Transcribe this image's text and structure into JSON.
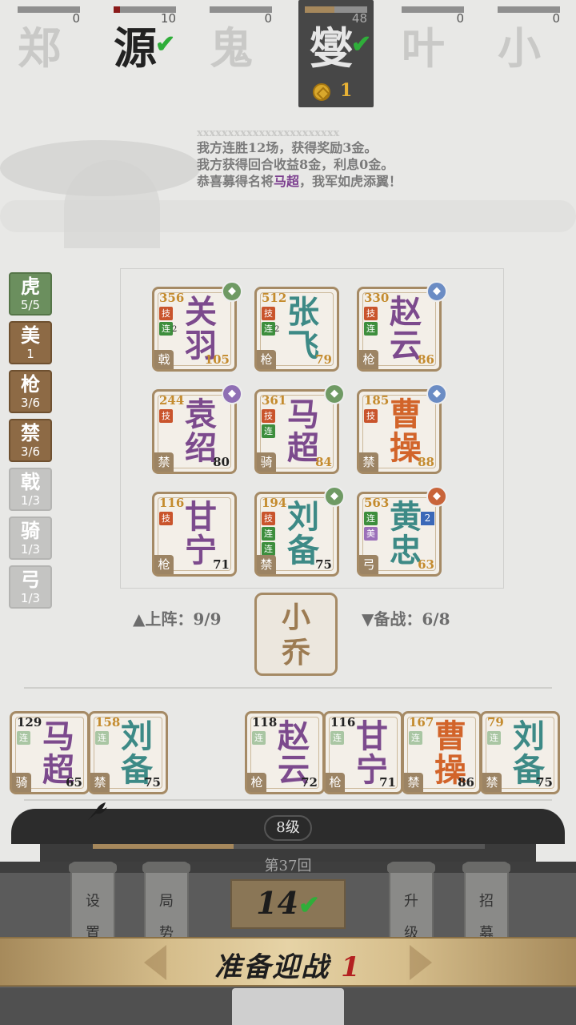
{
  "players": [
    {
      "name": "郑",
      "hp": 0,
      "hp_fill": 0,
      "style": "faded"
    },
    {
      "name": "源",
      "hp": 10,
      "hp_fill": 0.1,
      "style": "dark",
      "ready": "✔"
    },
    {
      "name": "鬼",
      "hp": 0,
      "hp_fill": 0,
      "style": "faded"
    },
    {
      "name": "燮",
      "hp": 48,
      "hp_fill": 0.48,
      "style": "self",
      "ready": "✔",
      "gold": "1"
    },
    {
      "name": "叶",
      "hp": 0,
      "hp_fill": 0,
      "style": "faded"
    },
    {
      "name": "小",
      "hp": 0,
      "hp_fill": 0,
      "style": "faded"
    }
  ],
  "log": {
    "faded_line": "xxxxxxxxxxxxxxxxxxxxxxx",
    "line1": "我方连胜12场，获得奖励3金。",
    "line2": "我方获得回合收益8金，利息0金。",
    "line3_pre": "恭喜募得名将",
    "line3_hero": "马超",
    "line3_post": "，我军如虎添翼！"
  },
  "traits": [
    {
      "name": "虎",
      "count": "5/5",
      "color": "green"
    },
    {
      "name": "美",
      "count": "1",
      "color": "brown"
    },
    {
      "name": "枪",
      "count": "3/6",
      "color": "brown"
    },
    {
      "name": "禁",
      "count": "3/6",
      "color": "brown"
    },
    {
      "name": "戟",
      "count": "1/3",
      "color": "grey"
    },
    {
      "name": "骑",
      "count": "1/3",
      "color": "grey"
    },
    {
      "name": "弓",
      "count": "1/3",
      "color": "grey"
    }
  ],
  "board": [
    {
      "name": "关羽",
      "power": "356",
      "level": "105",
      "type": "戟",
      "color": "purple",
      "skill": "技",
      "combo": "连",
      "combo_sub": "2",
      "badge": "crossed-swords-icon",
      "badge_color": "green"
    },
    {
      "name": "张飞",
      "power": "512",
      "level": "79",
      "type": "枪",
      "color": "teal",
      "skill": "技",
      "combo": "连",
      "combo_sub": "2"
    },
    {
      "name": "赵云",
      "power": "330",
      "level": "86",
      "type": "枪",
      "color": "purple",
      "skill": "技",
      "combo": "连",
      "badge": "book-icon",
      "badge_color": "blue"
    },
    {
      "name": "袁绍",
      "power": "244",
      "level": "80",
      "type": "禁",
      "color": "purple",
      "skill": "技",
      "badge": "scroll-icon",
      "badge_color": "purple"
    },
    {
      "name": "马超",
      "power": "361",
      "level": "84",
      "type": "骑",
      "color": "purple",
      "skill": "技",
      "combo": "连",
      "badge": "helmet-icon",
      "badge_color": "green"
    },
    {
      "name": "曹操",
      "power": "185",
      "level": "88",
      "type": "禁",
      "color": "orange",
      "skill": "技",
      "badge": "sword-icon",
      "badge_color": "blue"
    },
    {
      "name": "甘宁",
      "power": "116",
      "level": "71",
      "type": "枪",
      "color": "purple",
      "skill": "技"
    },
    {
      "name": "刘备",
      "power": "194",
      "level": "75",
      "type": "禁",
      "color": "teal",
      "skill": "技",
      "combo": "连",
      "combo2": "连",
      "badge": "sword-icon",
      "badge_color": "green"
    },
    {
      "name": "黄忠",
      "power": "563",
      "level": "63",
      "type": "弓",
      "color": "teal",
      "combo": "连",
      "purple_tag": "美",
      "star": "2",
      "badge": "bow-icon",
      "badge_color": "orange"
    }
  ],
  "deploy": {
    "on_label": "▲上阵：9/9",
    "bench_label": "▼备战：6/8",
    "advisor": "小乔"
  },
  "bench": [
    {
      "name": "马超",
      "power": "129",
      "level": "65",
      "type": "骑",
      "color": "purple",
      "power_color": "black"
    },
    {
      "name": "刘备",
      "power": "158",
      "level": "75",
      "type": "禁",
      "color": "teal",
      "power_color": "gold"
    },
    {
      "name": "赵云",
      "power": "118",
      "level": "72",
      "type": "枪",
      "color": "purple",
      "power_color": "black"
    },
    {
      "name": "甘宁",
      "power": "116",
      "level": "71",
      "type": "枪",
      "color": "purple",
      "power_color": "black"
    },
    {
      "name": "曹操",
      "power": "167",
      "level": "86",
      "type": "禁",
      "color": "orange",
      "power_color": "gold"
    },
    {
      "name": "刘备",
      "power": "79",
      "level": "75",
      "type": "禁",
      "color": "teal",
      "power_color": "gold"
    }
  ],
  "bottom": {
    "level": "8级",
    "xp_fill": 0.36,
    "round": "第37回",
    "timer": "14",
    "timer_check": "✔",
    "buttons": [
      {
        "label": "设置",
        "name": "settings-button"
      },
      {
        "label": "局势",
        "name": "situation-button"
      },
      {
        "label": "升级",
        "name": "upgrade-button"
      },
      {
        "label": "招募",
        "name": "recruit-button"
      }
    ],
    "banner_text": "准备迎战",
    "banner_num": "1"
  }
}
